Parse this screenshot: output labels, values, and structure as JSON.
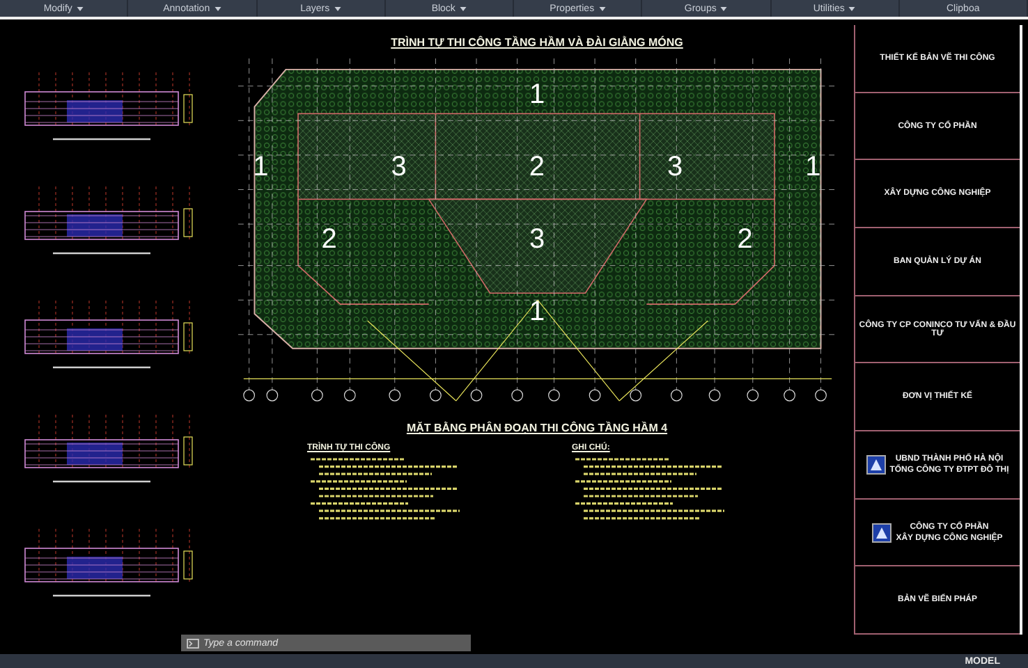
{
  "ribbon": {
    "panels": [
      {
        "label": "Modify",
        "dropdown": true
      },
      {
        "label": "Annotation",
        "dropdown": true
      },
      {
        "label": "Layers",
        "dropdown": true
      },
      {
        "label": "Block",
        "dropdown": true
      },
      {
        "label": "Properties",
        "dropdown": true
      },
      {
        "label": "Groups",
        "dropdown": true
      },
      {
        "label": "Utilities",
        "dropdown": true
      },
      {
        "label": "Clipboa",
        "dropdown": false
      }
    ]
  },
  "sheet": {
    "title": "TRÌNH TỰ THI CÔNG TẦNG HẦM VÀ ĐÀI GIẰNG MÓNG",
    "zone_rows": [
      [
        "1"
      ],
      [
        "1",
        "3",
        "2",
        "3",
        "1"
      ],
      [
        "2",
        "3",
        "2"
      ],
      [
        "1"
      ]
    ],
    "subtitle": "MẶT BẰNG PHÂN ĐOẠN THI CÔNG TẦNG HẦM 4",
    "notes": [
      {
        "heading": "TRÌNH TỰ THI CÔNG"
      },
      {
        "heading": "GHI CHÚ:"
      }
    ]
  },
  "title_block": [
    {
      "kind": "text",
      "text": "THIẾT KẾ BẢN VẼ THI CÔNG"
    },
    {
      "kind": "text",
      "text": "CÔNG TY CỔ PHẦN"
    },
    {
      "kind": "text",
      "text": "XÂY DỰNG CÔNG NGHIỆP"
    },
    {
      "kind": "text",
      "text": "BAN QUẢN LÝ DỰ ÁN"
    },
    {
      "kind": "text",
      "text": "CÔNG TY CP CONINCO TƯ VẤN & ĐẦU TƯ"
    },
    {
      "kind": "text",
      "text": "ĐƠN VỊ THIẾT KẾ"
    },
    {
      "kind": "logo",
      "text": "UBND THÀNH PHỐ HÀ NỘI",
      "text2": "TỔNG CÔNG TY ĐTPT ĐÔ THỊ"
    },
    {
      "kind": "logo",
      "text": "CÔNG TY CỔ PHẦN",
      "text2": "XÂY DỰNG CÔNG NGHIỆP"
    },
    {
      "kind": "text",
      "text": "BẢN VẼ BIỂN PHÁP"
    }
  ],
  "command_line": {
    "placeholder": "Type a command"
  },
  "status_bar": {
    "mode": "MODEL"
  }
}
